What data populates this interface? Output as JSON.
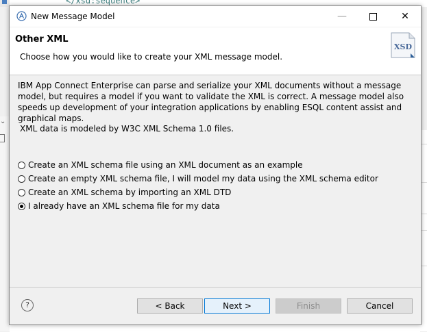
{
  "background": {
    "code_fragment": "</xsd:sequence>"
  },
  "dialog": {
    "title": "New Message Model",
    "window_controls": {
      "minimize": "—",
      "close": "✕"
    },
    "header": {
      "title": "Other XML",
      "description": "Choose how you would like to create your XML message model.",
      "icon_label": "XSD"
    },
    "body": {
      "intro": "IBM App Connect Enterprise can parse and serialize your XML documents without a message model, but requires a model if you want to validate the XML is correct. A message model also speeds up development of your integration applications by enabling ESQL content assist and graphical maps.",
      "schema_note": "XML data is modeled by W3C XML Schema 1.0 files.",
      "options": [
        {
          "label": "Create an XML schema file using an XML document as an example",
          "selected": false
        },
        {
          "label": "Create an empty XML schema file, I will model my data using the XML schema editor",
          "selected": false
        },
        {
          "label": "Create an XML schema by importing an XML DTD",
          "selected": false
        },
        {
          "label": "I already have an XML schema file for my data",
          "selected": true
        }
      ]
    },
    "footer": {
      "help": "?",
      "back": "< Back",
      "next": "Next >",
      "finish": "Finish",
      "cancel": "Cancel"
    }
  }
}
